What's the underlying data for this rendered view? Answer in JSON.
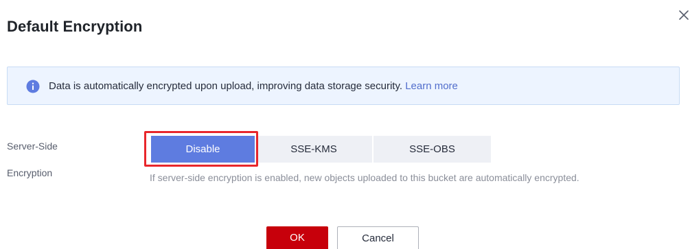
{
  "dialog": {
    "title": "Default Encryption",
    "close_icon": "close-icon"
  },
  "info": {
    "icon": "info-icon",
    "text": "Data is automatically encrypted upon upload, improving data storage security.",
    "link": "Learn more"
  },
  "encryption": {
    "label_line1": "Server-Side",
    "label_line2": "Encryption",
    "options": [
      {
        "label": "Disable",
        "selected": true
      },
      {
        "label": "SSE-KMS",
        "selected": false
      },
      {
        "label": "SSE-OBS",
        "selected": false
      }
    ],
    "hint": "If server-side encryption is enabled, new objects uploaded to this bucket are automatically encrypted."
  },
  "footer": {
    "ok_label": "OK",
    "cancel_label": "Cancel"
  },
  "colors": {
    "primary_button": "#c7000b",
    "selected_segment": "#5e7ce0",
    "unselected_segment": "#eef0f5",
    "link": "#526ecc",
    "info_background": "#edf4ff",
    "highlight_border": "#e8262b"
  }
}
